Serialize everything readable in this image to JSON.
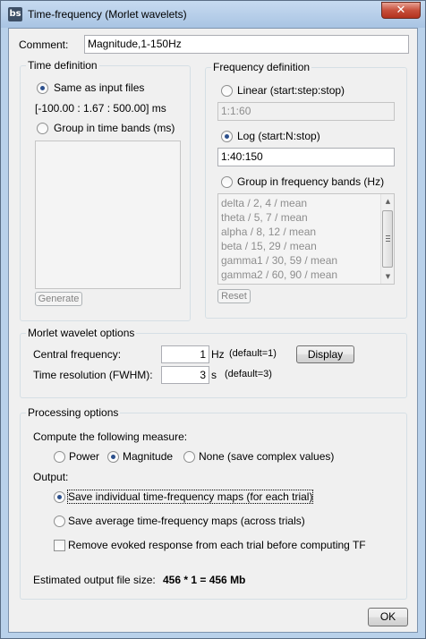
{
  "window": {
    "title": "Time-frequency (Morlet wavelets)",
    "app_icon_text": "bs",
    "close_glyph": "✕"
  },
  "comment": {
    "label": "Comment:",
    "value": "Magnitude,1-150Hz"
  },
  "time_definition": {
    "title": "Time definition",
    "same_as_input_label": "Same as input files",
    "same_as_input_checked": true,
    "time_range_text": "[-100.00 : 1.67 : 500.00] ms",
    "group_bands_label": "Group in time bands (ms)",
    "group_bands_checked": false,
    "generate_label": "Generate"
  },
  "frequency_definition": {
    "title": "Frequency definition",
    "linear_label": "Linear (start:step:stop)",
    "linear_checked": false,
    "linear_value": "1:1:60",
    "log_label": "Log (start:N:stop)",
    "log_checked": true,
    "log_value": "1:40:150",
    "group_bands_label": "Group in frequency bands (Hz)",
    "group_bands_checked": false,
    "bands": [
      "delta / 2, 4 / mean",
      "theta / 5, 7 / mean",
      "alpha / 8, 12 / mean",
      "beta / 15, 29 / mean",
      "gamma1 / 30, 59 / mean",
      "gamma2 / 60, 90 / mean"
    ],
    "reset_label": "Reset"
  },
  "morlet": {
    "title": "Morlet wavelet options",
    "central_freq_label": "Central frequency:",
    "central_freq_value": "1",
    "central_freq_unit": "Hz",
    "central_freq_default": "(default=1)",
    "fwhm_label": "Time resolution (FWHM):",
    "fwhm_value": "3",
    "fwhm_unit": "s",
    "fwhm_default": "(default=3)",
    "display_label": "Display"
  },
  "processing": {
    "title": "Processing options",
    "measure_label": "Compute the following measure:",
    "measure_options": [
      {
        "label": "Power",
        "checked": false
      },
      {
        "label": "Magnitude",
        "checked": true
      },
      {
        "label": "None (save complex values)",
        "checked": false
      }
    ],
    "output_label": "Output:",
    "save_individual_label": "Save individual time-frequency maps (for each trial)",
    "save_individual_checked": true,
    "save_average_label": "Save average time-frequency maps (across trials)",
    "save_average_checked": false,
    "remove_evoked_label": "Remove evoked response from each trial before computing TF",
    "remove_evoked_checked": false,
    "estimated_size_label": "Estimated output file size:",
    "estimated_size_value": "456 * 1 = 456 Mb"
  },
  "footer": {
    "ok_label": "OK"
  }
}
